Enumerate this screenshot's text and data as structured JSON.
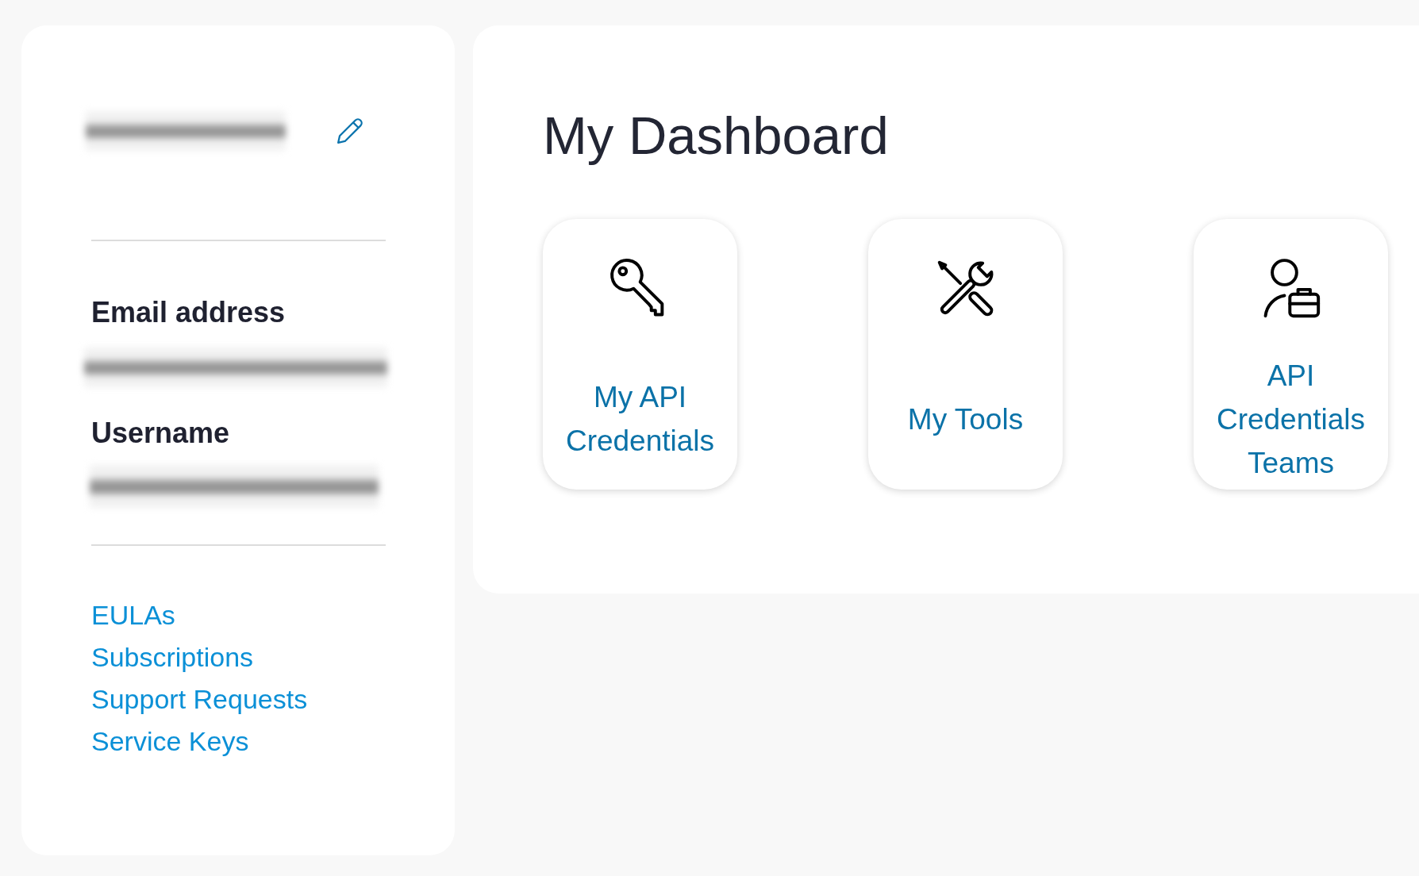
{
  "profile": {
    "name_redacted": true,
    "fields": [
      {
        "label": "Email address",
        "value_redacted": true
      },
      {
        "label": "Username",
        "value_redacted": true
      }
    ],
    "links": [
      "EULAs",
      "Subscriptions",
      "Support Requests",
      "Service Keys"
    ]
  },
  "dashboard": {
    "title": "My Dashboard",
    "cards": [
      {
        "kind": "credentials",
        "label": "My API Credentials"
      },
      {
        "kind": "tools",
        "label": "My Tools"
      },
      {
        "kind": "teams",
        "label": "API Credentials Teams"
      }
    ]
  }
}
